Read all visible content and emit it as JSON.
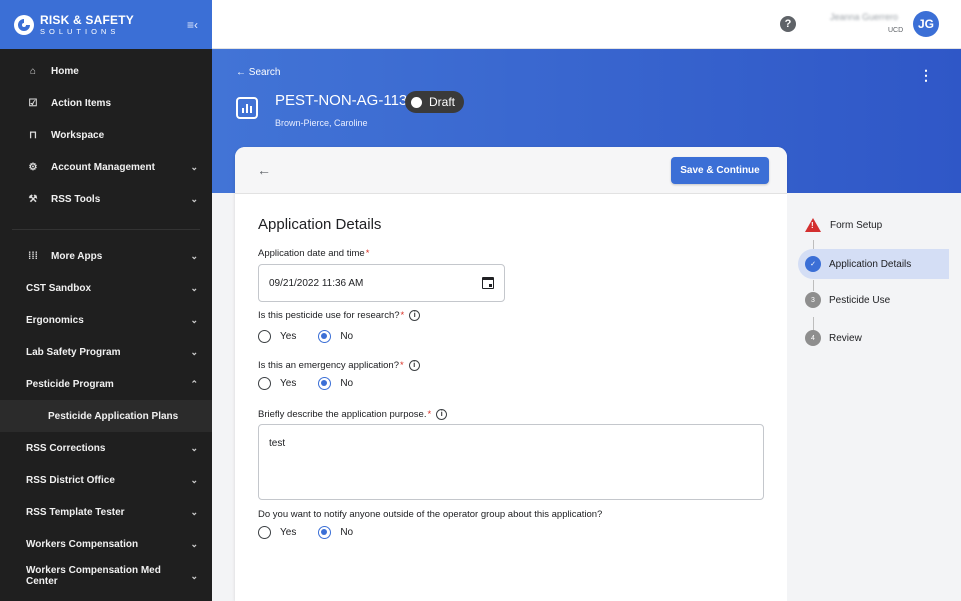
{
  "brand": {
    "line1": "RISK & SAFETY",
    "line2": "SOLUTIONS",
    "collapse_icon": "menu-collapse-icon"
  },
  "sidebar": {
    "primary": [
      {
        "label": "Home",
        "icon": "home-icon"
      },
      {
        "label": "Action Items",
        "icon": "checkbox-icon"
      },
      {
        "label": "Workspace",
        "icon": "briefcase-icon"
      },
      {
        "label": "Account Management",
        "icon": "gear-icon",
        "expandable": true
      },
      {
        "label": "RSS Tools",
        "icon": "tools-icon",
        "expandable": true
      }
    ],
    "more_apps": "More Apps",
    "apps": [
      {
        "label": "CST Sandbox"
      },
      {
        "label": "Ergonomics"
      },
      {
        "label": "Lab Safety Program"
      },
      {
        "label": "Pesticide Program",
        "expanded": true
      },
      {
        "label": "Pesticide Application Plans",
        "sub": true
      },
      {
        "label": "RSS Corrections"
      },
      {
        "label": "RSS District Office"
      },
      {
        "label": "RSS Template Tester"
      },
      {
        "label": "Workers Compensation"
      },
      {
        "label": "Workers Compensation Med Center"
      }
    ]
  },
  "topbar": {
    "help": "?",
    "user_name": "Jeanna Guerrero",
    "user_org": "UCD",
    "avatar_initials": "JG"
  },
  "header": {
    "back_label": "← Search",
    "record_id": "PEST-NON-AG-113",
    "status": "Draft",
    "owner": "Brown-Pierce, Caroline",
    "more_icon": "⋮"
  },
  "card": {
    "back": "←",
    "save_label": "Save & Continue",
    "section_title": "Application Details",
    "date_label": "Application date and time",
    "date_value": "09/21/2022 11:36 AM",
    "q_research": "Is this pesticide use for research?",
    "q_emergency": "Is this an emergency application?",
    "q_purpose": "Briefly describe the application purpose.",
    "purpose_value": "test",
    "q_notify": "Do you want to notify anyone outside of the operator group about this application?",
    "yes": "Yes",
    "no": "No",
    "required_mark": "*",
    "info_glyph": "i"
  },
  "steps": [
    {
      "label": "Form Setup",
      "state": "error"
    },
    {
      "label": "Application Details",
      "state": "active"
    },
    {
      "label": "Pesticide Use",
      "number": "3"
    },
    {
      "label": "Review",
      "number": "4"
    }
  ]
}
